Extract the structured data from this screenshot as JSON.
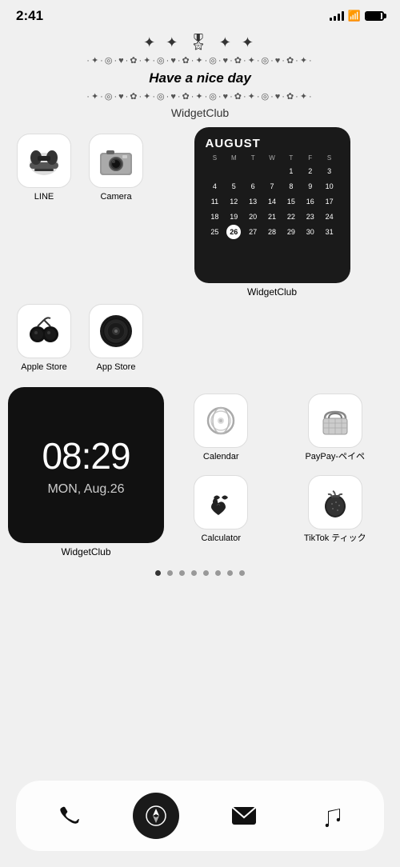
{
  "statusBar": {
    "time": "2:41"
  },
  "header": {
    "bowDecoration": "✦ ✧ 𝓑𝓸𝔀 ✧ ✦",
    "decoLine1": "·✦·◎·♥·✿·✦·◎·♥·✿·✦·◎·♥·✿·✦·",
    "niceDayText": "Have a nice day",
    "decoLine2": "·✦·◎·♥·✿·✦·◎·♥·✿·✦·◎·♥·✿·✦·",
    "widgetClubLabel": "WidgetClub"
  },
  "apps": {
    "row1": [
      {
        "id": "line",
        "label": "LINE",
        "icon": "phone-retro"
      },
      {
        "id": "camera",
        "label": "Camera",
        "icon": "camera"
      }
    ],
    "row2": [
      {
        "id": "apple-store",
        "label": "Apple Store",
        "icon": "apple-store"
      },
      {
        "id": "app-store",
        "label": "App Store",
        "icon": "app-store"
      }
    ]
  },
  "calendar": {
    "month": "AUGUST",
    "dayNames": [
      "S",
      "M",
      "T",
      "W",
      "T",
      "F",
      "S"
    ],
    "days": [
      "",
      "",
      "",
      "",
      "1",
      "2",
      "3",
      "4",
      "5",
      "6",
      "7",
      "8",
      "9",
      "10",
      "11",
      "12",
      "13",
      "14",
      "15",
      "16",
      "17",
      "18",
      "19",
      "20",
      "21",
      "22",
      "23",
      "24",
      "25",
      "26",
      "27",
      "28",
      "29",
      "30",
      "31"
    ],
    "today": "26",
    "widgetLabel": "WidgetClub"
  },
  "clock": {
    "time": "08:29",
    "date": "MON, Aug.26",
    "widgetLabel": "WidgetClub"
  },
  "rightApps": [
    {
      "id": "calendar",
      "label": "Calendar",
      "icon": "ring"
    },
    {
      "id": "paypay",
      "label": "PayPay-ペイペ",
      "icon": "basket"
    },
    {
      "id": "calculator",
      "label": "Calculator",
      "icon": "hearts"
    },
    {
      "id": "tiktok",
      "label": "TikTok ティック",
      "icon": "strawberry"
    }
  ],
  "pageDots": {
    "total": 8,
    "active": 0
  },
  "dock": [
    {
      "id": "phone",
      "label": "Phone",
      "icon": "phone"
    },
    {
      "id": "safari",
      "label": "Safari",
      "icon": "compass"
    },
    {
      "id": "mail",
      "label": "Mail",
      "icon": "mail"
    },
    {
      "id": "music",
      "label": "Music",
      "icon": "music"
    }
  ]
}
